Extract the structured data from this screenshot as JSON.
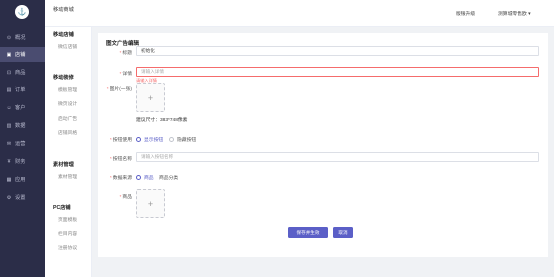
{
  "sidebar": {
    "logo": "⚓",
    "items": [
      {
        "icon": "⊙",
        "label": "概况"
      },
      {
        "icon": "▣",
        "label": "店铺"
      },
      {
        "icon": "⊡",
        "label": "商品"
      },
      {
        "icon": "▤",
        "label": "订单"
      },
      {
        "icon": "☺",
        "label": "客户"
      },
      {
        "icon": "▥",
        "label": "数据"
      },
      {
        "icon": "✉",
        "label": "运营"
      },
      {
        "icon": "¥",
        "label": "财务"
      },
      {
        "icon": "▦",
        "label": "应用"
      },
      {
        "icon": "⚙",
        "label": "设置"
      }
    ]
  },
  "submenu": {
    "sections": [
      {
        "title": "移动店铺",
        "items": [
          "微信店铺"
        ]
      },
      {
        "title": "移动装修",
        "items": [
          "模板管理",
          "微页设计",
          "启动广告",
          "店铺风格"
        ]
      },
      {
        "title": "素材管理",
        "items": [
          "素材管理"
        ]
      },
      {
        "title": "PC店铺",
        "items": [
          "页面模板",
          "栏目内容",
          "注册协议"
        ]
      }
    ]
  },
  "header": {
    "breadcrumb": "移动商城",
    "upgrade": "版银升级",
    "user": "测算城零售欧 ▾"
  },
  "form": {
    "title": "图文广告编辑",
    "title_label": "标题",
    "title_value": "初始化",
    "detail_label": "详情",
    "detail_placeholder": "请输入详情",
    "detail_error": "请输入详情",
    "image_label": "图片(一张)",
    "image_hint": "建议尺寸：383*748像素",
    "button_label": "按钮使用",
    "button_options": [
      "显示按钮",
      "隐藏按钮"
    ],
    "button_name_label": "按钮名称",
    "button_name_placeholder": "请输入按钮名称",
    "source_label": "数据来源",
    "source_options": [
      "商品",
      "商品分类"
    ],
    "product_label": "商品",
    "save_label": "保存并生效",
    "cancel_label": "取消"
  }
}
